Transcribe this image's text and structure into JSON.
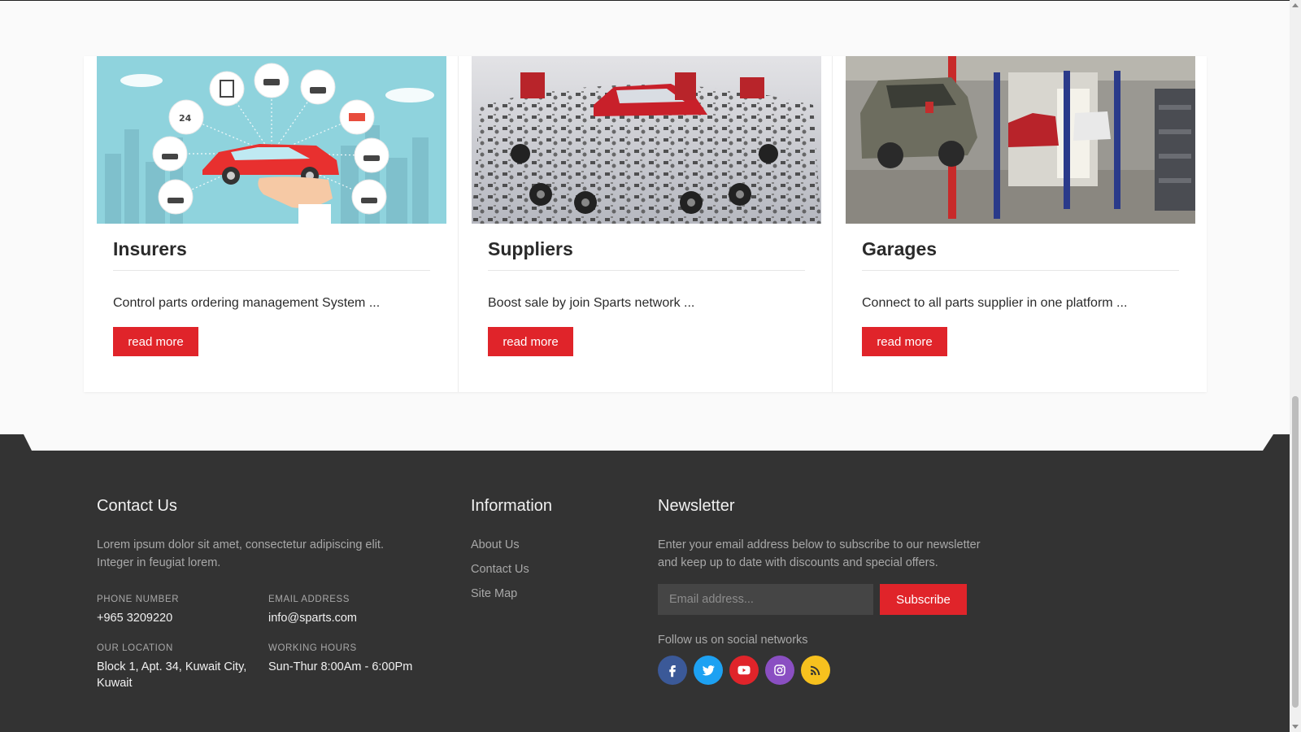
{
  "cards": [
    {
      "title": "Insurers",
      "description": "Control parts ordering management System ...",
      "button": "read more"
    },
    {
      "title": "Suppliers",
      "description": "Boost sale by join Sparts network ...",
      "button": "read more"
    },
    {
      "title": "Garages",
      "description": "Connect to all parts supplier in one platform ...",
      "button": "read more"
    }
  ],
  "contact": {
    "title": "Contact Us",
    "text1": "Lorem ipsum dolor sit amet, consectetur adipiscing elit.",
    "text2": "Integer in feugiat lorem.",
    "phone_label": "PHONE NUMBER",
    "phone": "+965 3209220",
    "email_label": "EMAIL ADDRESS",
    "email": "info@sparts.com",
    "location_label": "OUR LOCATION",
    "location1": "Block 1, Apt. 34, Kuwait City,",
    "location2": "Kuwait",
    "hours_label": "WORKING HOURS",
    "hours": "Sun-Thur 8:00Am - 6:00Pm"
  },
  "information": {
    "title": "Information",
    "links": [
      "About Us",
      "Contact Us",
      "Site Map"
    ]
  },
  "newsletter": {
    "title": "Newsletter",
    "text1": "Enter your email address below to subscribe to our newsletter",
    "text2": "and keep up to date with discounts and special offers.",
    "placeholder": "Email address...",
    "button": "Subscribe",
    "follow": "Follow us on social networks"
  },
  "social": [
    {
      "name": "facebook-icon",
      "color": "#3b5998"
    },
    {
      "name": "twitter-icon",
      "color": "#1da1f2"
    },
    {
      "name": "youtube-icon",
      "color": "#e0242a"
    },
    {
      "name": "instagram-icon",
      "color": "#8a4fc2"
    },
    {
      "name": "rss-icon",
      "color": "#f7c11e"
    }
  ],
  "colors": {
    "accent": "#e0242a",
    "footer_bg": "#333333"
  }
}
